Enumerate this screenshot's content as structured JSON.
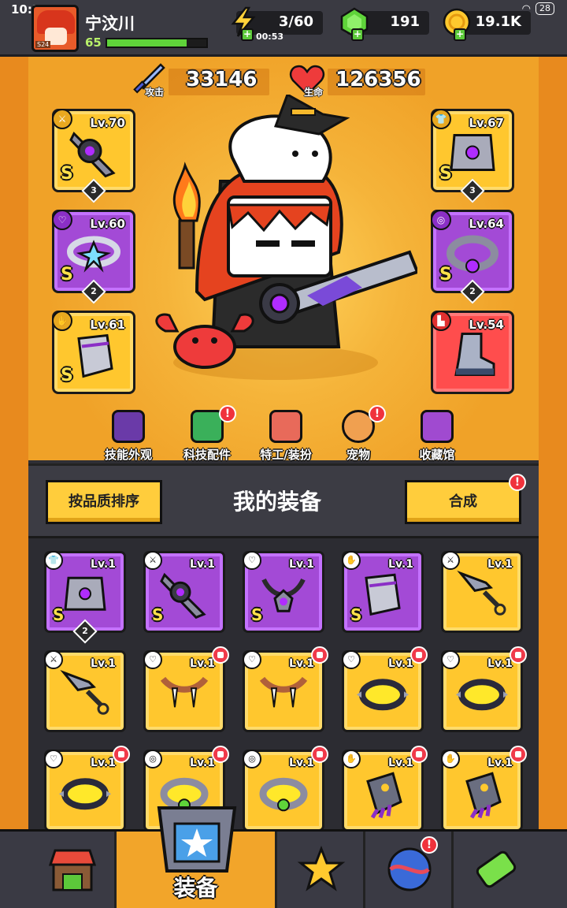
{
  "status_bar": {
    "time": "10:13",
    "battery": "28"
  },
  "player": {
    "name": "宁汶川",
    "level": "65",
    "avatar_tag": "S24",
    "xp_fraction": 0.8
  },
  "resources": {
    "energy": {
      "value": "3/60",
      "timer": "00:53"
    },
    "gems": {
      "value": "191"
    },
    "coins": {
      "value": "19.1K"
    }
  },
  "stats": {
    "attack": {
      "label": "攻击",
      "value": "33146"
    },
    "health": {
      "label": "生命",
      "value": "126356"
    }
  },
  "equipped": {
    "weapon": {
      "level": "Lv.70",
      "grade": "S",
      "stars": "3",
      "rarity": "yellow"
    },
    "armor": {
      "level": "Lv.67",
      "grade": "S",
      "stars": "3",
      "rarity": "yellow"
    },
    "necklace": {
      "level": "Lv.60",
      "grade": "S",
      "stars": "2",
      "rarity": "purple"
    },
    "belt": {
      "level": "Lv.64",
      "grade": "S",
      "stars": "2",
      "rarity": "purple"
    },
    "gloves": {
      "level": "Lv.61",
      "grade": "S",
      "rarity": "yellow"
    },
    "boots": {
      "level": "Lv.54",
      "rarity": "red"
    }
  },
  "menu": [
    {
      "label": "技能外观",
      "alert": false
    },
    {
      "label": "科技配件",
      "alert": true
    },
    {
      "label": "特工/装扮",
      "alert": false
    },
    {
      "label": "宠物",
      "alert": true
    },
    {
      "label": "收藏馆",
      "alert": false
    }
  ],
  "inventory": {
    "title": "我的装备",
    "sort_button": "按品质排序",
    "merge_button": "合成",
    "items": [
      {
        "level": "Lv.1",
        "grade": "S",
        "stars": "2",
        "rarity": "purple",
        "kind": "armor"
      },
      {
        "level": "Lv.1",
        "grade": "S",
        "rarity": "purple",
        "kind": "weapon"
      },
      {
        "level": "Lv.1",
        "grade": "S",
        "rarity": "purple",
        "kind": "necklace"
      },
      {
        "level": "Lv.1",
        "grade": "S",
        "rarity": "purple",
        "kind": "gloves"
      },
      {
        "level": "Lv.1",
        "rarity": "yellow",
        "kind": "kunai"
      },
      {
        "level": "Lv.1",
        "rarity": "yellow",
        "kind": "kunai"
      },
      {
        "level": "Lv.1",
        "rarity": "yellow",
        "kind": "fang"
      },
      {
        "level": "Lv.1",
        "rarity": "yellow",
        "kind": "fang"
      },
      {
        "level": "Lv.1",
        "rarity": "yellow",
        "kind": "collar"
      },
      {
        "level": "Lv.1",
        "rarity": "yellow",
        "kind": "collar"
      },
      {
        "level": "Lv.1",
        "rarity": "yellow",
        "kind": "collar"
      },
      {
        "level": "Lv.1",
        "rarity": "yellow",
        "kind": "belt"
      },
      {
        "level": "Lv.1",
        "rarity": "yellow",
        "kind": "belt"
      },
      {
        "level": "Lv.1",
        "rarity": "yellow",
        "kind": "gauntlet"
      },
      {
        "level": "Lv.1",
        "rarity": "yellow",
        "kind": "gauntlet"
      }
    ]
  },
  "bottom_nav": {
    "active_label": "装备"
  }
}
